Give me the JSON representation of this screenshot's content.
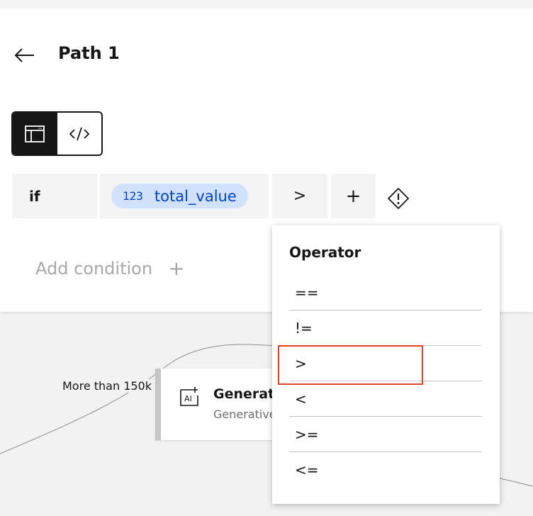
{
  "panel": {
    "title": "Path 1"
  },
  "condition": {
    "keyword": "if",
    "variable_type_label": "123",
    "variable_name": "total_value",
    "operator": ">",
    "add_symbol": "+"
  },
  "add_condition": {
    "label": "Add condition",
    "plus": "+"
  },
  "operator_menu": {
    "title": "Operator",
    "options": [
      "==",
      "!=",
      ">",
      "<",
      ">=",
      "<="
    ],
    "highlighted": ">"
  },
  "canvas": {
    "edge_label": "More than 150k",
    "node": {
      "title": "Generation",
      "subtitle": "Generative AI"
    }
  },
  "colors": {
    "pill_bg": "#d0e2ff",
    "pill_text": "#0043ce",
    "highlight_border": "#e1442b",
    "toggle_active": "#161616"
  }
}
